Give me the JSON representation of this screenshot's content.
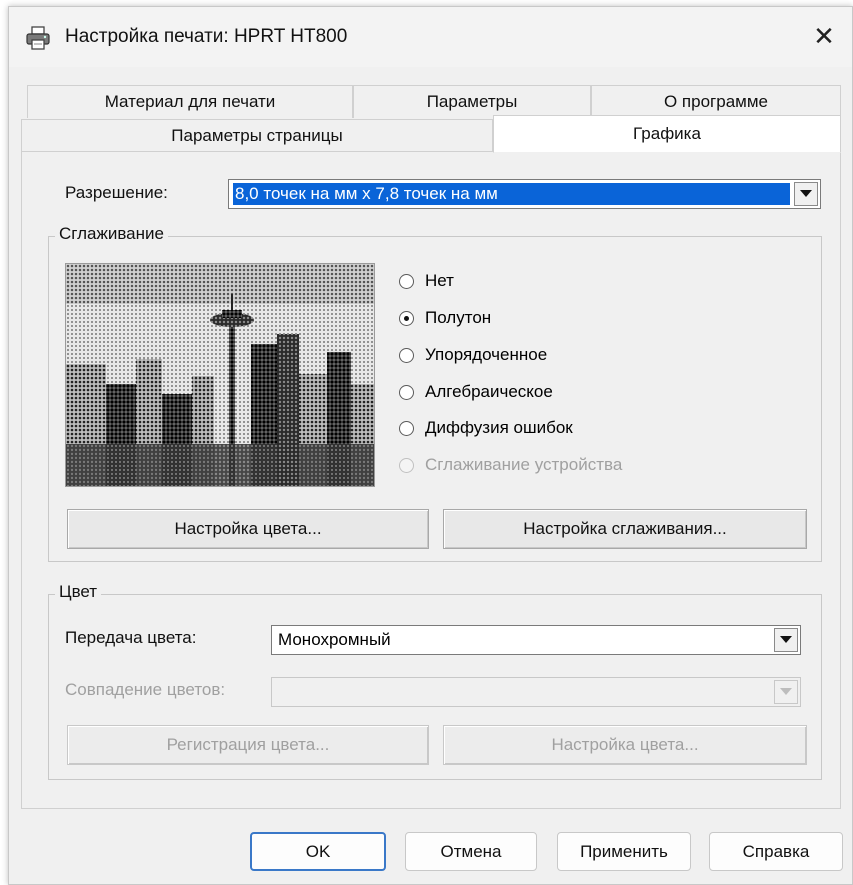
{
  "window": {
    "title": "Настройка печати: HPRT HT800",
    "close_glyph": "✕"
  },
  "tabs": {
    "row1": [
      "Материал для печати",
      "Параметры",
      "О программе"
    ],
    "row2": [
      "Параметры страницы",
      "Графика"
    ],
    "active": "Графика"
  },
  "resolution": {
    "label": "Разрешение:",
    "value": "8,0 точек на мм x 7,8 точек на мм"
  },
  "dithering": {
    "group_title": "Сглаживание",
    "options": [
      {
        "label": "Нет",
        "checked": false,
        "enabled": true
      },
      {
        "label": "Полутон",
        "checked": true,
        "enabled": true
      },
      {
        "label": "Упорядоченное",
        "checked": false,
        "enabled": true
      },
      {
        "label": "Алгебраическое",
        "checked": false,
        "enabled": true
      },
      {
        "label": "Диффузия ошибок",
        "checked": false,
        "enabled": true
      },
      {
        "label": "Сглаживание устройства",
        "checked": false,
        "enabled": false
      }
    ],
    "color_setup_button": "Настройка цвета...",
    "dither_setup_button": "Настройка сглаживания..."
  },
  "color": {
    "group_title": "Цвет",
    "transfer_label": "Передача цвета:",
    "transfer_value": "Монохромный",
    "matching_label": "Совпадение цветов:",
    "matching_value": "",
    "register_button": "Регистрация цвета...",
    "setup_button": "Настройка цвета..."
  },
  "footer": {
    "ok": "OK",
    "cancel": "Отмена",
    "apply": "Применить",
    "help": "Справка"
  },
  "icons": {
    "title": "printer-icon",
    "close": "close-icon",
    "dropdown": "chevron-down-icon"
  }
}
